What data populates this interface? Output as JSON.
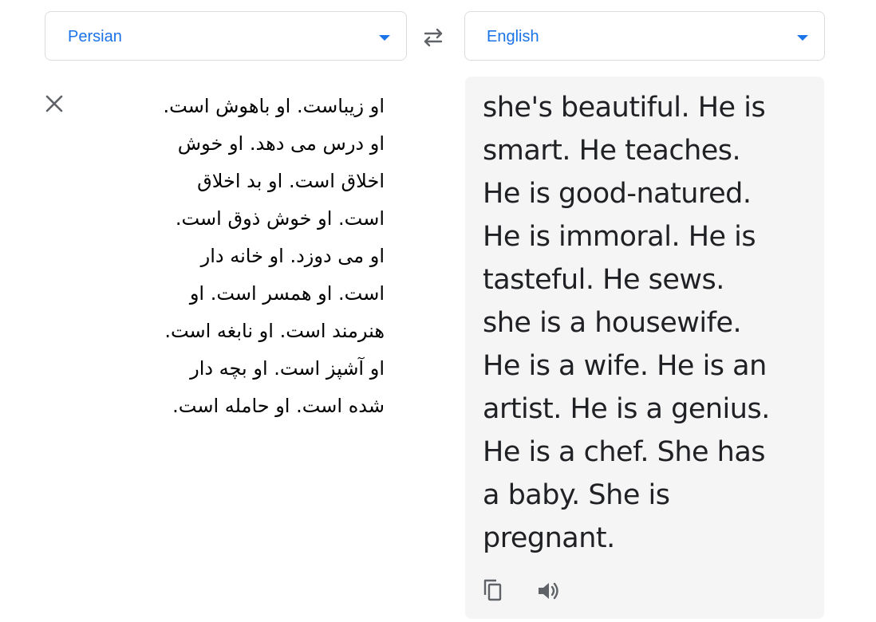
{
  "source_language": {
    "label": "Persian",
    "icon": "chevron-down-icon"
  },
  "target_language": {
    "label": "English",
    "icon": "chevron-down-icon"
  },
  "controls": {
    "swap_icon": "swap-languages-icon",
    "clear_icon": "close-icon",
    "copy_icon": "copy-icon",
    "listen_icon": "speaker-icon"
  },
  "colors": {
    "accent": "#1a73e8",
    "icon_gray": "#5f6368",
    "panel_bg": "#f5f5f5",
    "border": "#dadce0"
  },
  "source_text": "او زیباست. او باهوش است.\nاو درس می دهد. او خوش\nاخلاق است. او بد اخلاق\nاست. او خوش ذوق است.\nاو می دوزد.  او خانه دار\nاست. او همسر است. او\nهنرمند است. او نابغه است.\nاو آشپز است. او بچه دار\nشده است. او حامله است.",
  "translated_text": "she's beautiful. He is\nsmart. He teaches.\nHe is good-natured.\nHe is immoral. He is\ntasteful. He sews.\nshe is a housewife.\nHe is a wife. He is an\nartist. He is a genius.\nHe is a chef. She has\na baby. She is\npregnant."
}
